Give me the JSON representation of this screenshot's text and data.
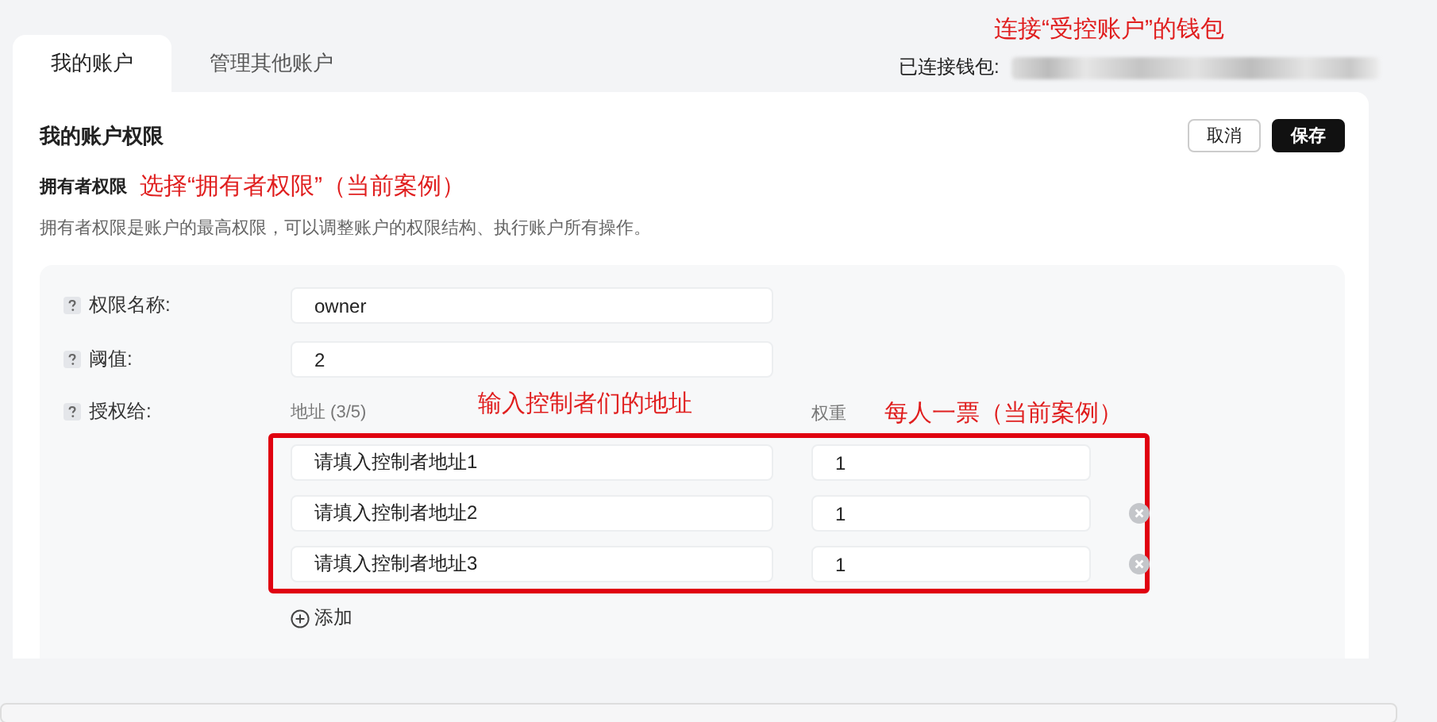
{
  "tabs": [
    {
      "label": "我的账户",
      "selected": true
    },
    {
      "label": "管理其他账户",
      "selected": false
    }
  ],
  "wallet": {
    "label": "已连接钱包:",
    "annotation": "连接“受控账户”的钱包"
  },
  "card": {
    "title": "我的账户权限",
    "buttons": [
      {
        "label": "取消",
        "kind": "secondary"
      },
      {
        "label": "保存",
        "kind": "primary"
      }
    ]
  },
  "permission": {
    "name": "拥有者权限",
    "annotation": "选择“拥有者权限”（当前案例）",
    "description": "拥有者权限是账户的最高权限，可以调整账户的权限结构、执行账户所有操作。"
  },
  "form": {
    "fields": [
      {
        "label": "权限名称:",
        "value": "owner"
      },
      {
        "label": "阈值:",
        "value": "2"
      }
    ],
    "grant": {
      "label": "授权给:",
      "address_header": "地址 (3/5)",
      "address_annotation": "输入控制者们的地址",
      "weight_header": "权重",
      "weight_annotation": "每人一票（当前案例）",
      "rows": [
        {
          "address": "请填入控制者地址1",
          "weight": "1",
          "removable": false
        },
        {
          "address": "请填入控制者地址2",
          "weight": "1",
          "removable": true
        },
        {
          "address": "请填入控制者地址3",
          "weight": "1",
          "removable": true
        }
      ],
      "add_label": "添加"
    }
  }
}
